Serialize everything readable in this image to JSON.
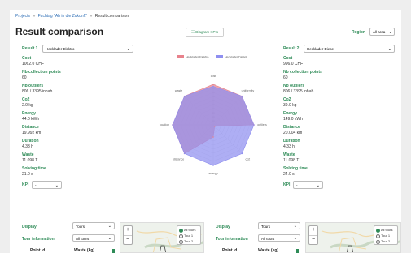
{
  "breadcrumb": {
    "items": [
      "Projects",
      "Fachtag \"Ab in die Zukunft\"",
      "Result comparison"
    ],
    "sep": "»"
  },
  "page": {
    "title": "Result comparison"
  },
  "toolbar": {
    "diagram_button": "☷ Diagram KPIs"
  },
  "region": {
    "label": "Region",
    "value": "All area"
  },
  "result1": {
    "label": "Result 1",
    "select": "Hecklader Elektro",
    "metrics": [
      {
        "label": "Cost",
        "value": "1062.0 CHF"
      },
      {
        "label": "Nb collection points",
        "value": "60"
      },
      {
        "label": "Nb outliers",
        "value": "806 / 3395 inhab."
      },
      {
        "label": "Co2",
        "value": "2.0 kg"
      },
      {
        "label": "Energy",
        "value": "44.0 kWh"
      },
      {
        "label": "Distance",
        "value": "19.992 km"
      },
      {
        "label": "Duration",
        "value": "4.33 h"
      },
      {
        "label": "Waste",
        "value": "11.098 T"
      },
      {
        "label": "Solving time",
        "value": "21.0 s"
      }
    ],
    "kpi": {
      "label": "KPI",
      "value": "-"
    }
  },
  "result2": {
    "label": "Result 2",
    "select": "Hecklader Diesel",
    "metrics": [
      {
        "label": "Cost",
        "value": "996.0 CHF"
      },
      {
        "label": "Nb collection points",
        "value": "60"
      },
      {
        "label": "Nb outliers",
        "value": "806 / 3395 inhab."
      },
      {
        "label": "Co2",
        "value": "39.0 kg"
      },
      {
        "label": "Energy",
        "value": "149.0 kWh"
      },
      {
        "label": "Distance",
        "value": "20.004 km"
      },
      {
        "label": "Duration",
        "value": "4.33 h"
      },
      {
        "label": "Waste",
        "value": "11.098 T"
      },
      {
        "label": "Solving time",
        "value": "24.0 s"
      }
    ],
    "kpi": {
      "label": "KPI",
      "value": "-"
    }
  },
  "chart_data": {
    "type": "radar",
    "title": "",
    "axes": [
      "cost",
      "uniformity",
      "outliers",
      "co2",
      "energy",
      "distance",
      "location",
      "waste"
    ],
    "ticks": [
      "100",
      "90",
      "80",
      "70",
      "60",
      "50",
      "40",
      "30",
      "20",
      "10"
    ],
    "rmax": 100,
    "series": [
      {
        "name": "Hecklader Elektro",
        "color": "#e8828c",
        "values": [
          100,
          100,
          100,
          5,
          30,
          100,
          100,
          100
        ]
      },
      {
        "name": "Hecklader Diesel",
        "color": "#8f8ff0",
        "values": [
          95,
          100,
          100,
          100,
          100,
          100,
          100,
          100
        ]
      }
    ]
  },
  "bottom_left": {
    "display_label": "Display",
    "display_value": "Tours",
    "tour_info_label": "Tour information",
    "tour_info_value": "All tours",
    "zoom_in": "+",
    "zoom_out": "−",
    "tour_options": [
      "All tours",
      "Tour 1",
      "Tour 2"
    ],
    "col_point": "Point id",
    "col_waste": "Waste (kg)"
  },
  "bottom_right": {
    "display_label": "Display",
    "display_value": "Tours",
    "tour_info_label": "Tour information",
    "tour_info_value": "All tours",
    "zoom_in": "+",
    "zoom_out": "−",
    "tour_options": [
      "All tours",
      "Tour 1",
      "Tour 2"
    ],
    "col_point": "Point id",
    "col_waste": "Waste (kg)"
  },
  "icons": {
    "chevron": "chevron-down-icon",
    "chevron_glyph": "⌄"
  }
}
